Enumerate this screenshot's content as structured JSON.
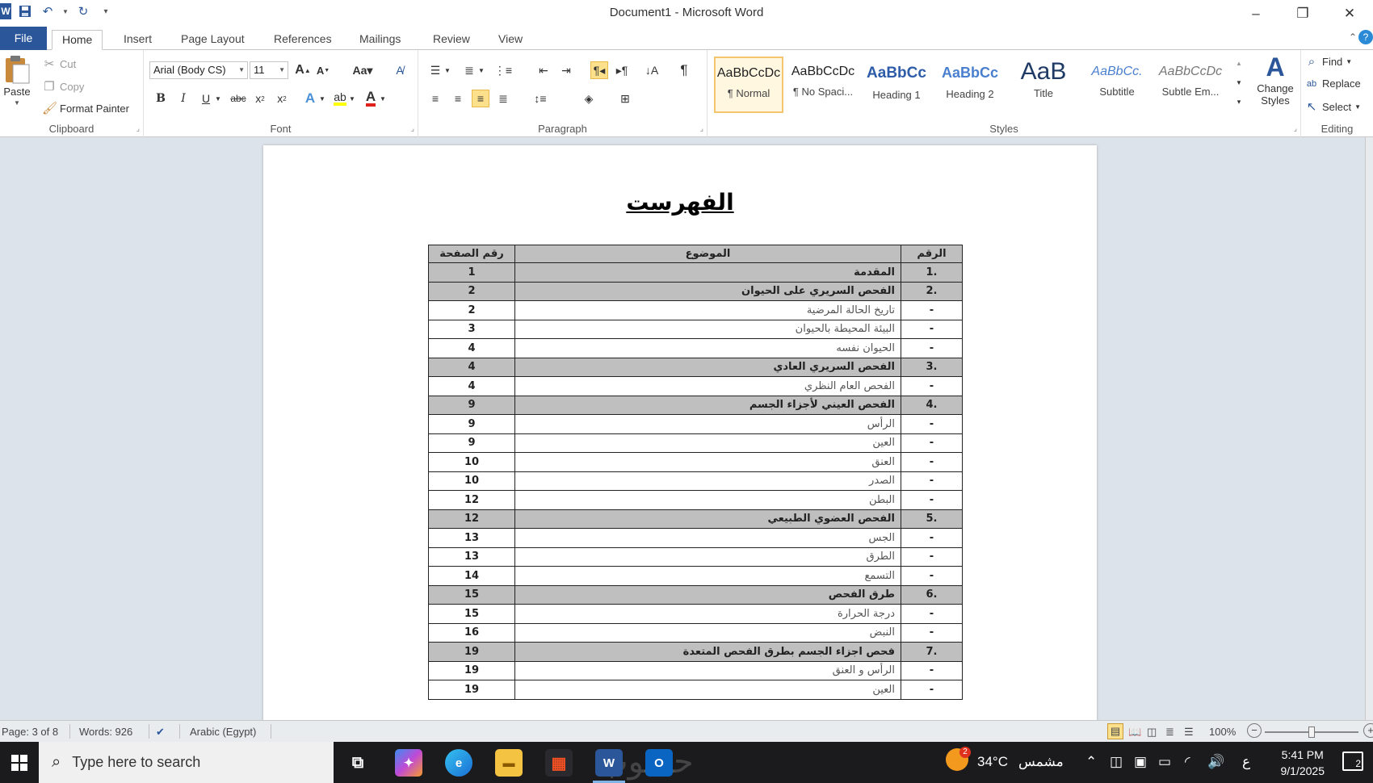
{
  "window": {
    "title": "Document1 - Microsoft Word"
  },
  "tabs": [
    "File",
    "Home",
    "Insert",
    "Page Layout",
    "References",
    "Mailings",
    "Review",
    "View"
  ],
  "ribbon": {
    "clipboard": {
      "label": "Clipboard",
      "paste": "Paste",
      "cut": "Cut",
      "copy": "Copy",
      "format_painter": "Format Painter"
    },
    "font": {
      "label": "Font",
      "family": "Arial (Body CS)",
      "size": "11"
    },
    "paragraph": {
      "label": "Paragraph"
    },
    "styles": {
      "label": "Styles",
      "items": [
        {
          "sample": "AaBbCcDc",
          "name": "¶ Normal"
        },
        {
          "sample": "AaBbCcDc",
          "name": "¶ No Spaci..."
        },
        {
          "sample": "AaBbCc",
          "name": "Heading 1"
        },
        {
          "sample": "AaBbCc",
          "name": "Heading 2"
        },
        {
          "sample": "AaB",
          "name": "Title"
        },
        {
          "sample": "AaBbCc.",
          "name": "Subtitle"
        },
        {
          "sample": "AaBbCcDc",
          "name": "Subtle Em..."
        }
      ],
      "change_styles": "Change Styles"
    },
    "editing": {
      "label": "Editing",
      "find": "Find",
      "replace": "Replace",
      "select": "Select"
    }
  },
  "document": {
    "heading": "الفهرست",
    "headers": {
      "num": "الرقم",
      "topic": "الموضوع",
      "page": "رقم الصفحة"
    },
    "rows": [
      {
        "num": ".1",
        "topic": "المقدمة",
        "page": "1",
        "main": true
      },
      {
        "num": ".2",
        "topic": "الفحص السريري على الحيوان",
        "page": "2",
        "main": true
      },
      {
        "num": "-",
        "topic": "تاريخ الحالة المرضية",
        "page": "2",
        "main": false
      },
      {
        "num": "-",
        "topic": "البيئة المحيطة بالحيوان",
        "page": "3",
        "main": false
      },
      {
        "num": "-",
        "topic": "الحيوان نفسه",
        "page": "4",
        "main": false
      },
      {
        "num": ".3",
        "topic": "الفحص السريري العادي",
        "page": "4",
        "main": true
      },
      {
        "num": "-",
        "topic": "الفحص العام النظري",
        "page": "4",
        "main": false
      },
      {
        "num": ".4",
        "topic": "الفحص العيني لأجزاء الجسم",
        "page": "9",
        "main": true
      },
      {
        "num": "-",
        "topic": "الرأس",
        "page": "9",
        "main": false
      },
      {
        "num": "-",
        "topic": "العين",
        "page": "9",
        "main": false
      },
      {
        "num": "-",
        "topic": "العنق",
        "page": "10",
        "main": false
      },
      {
        "num": "-",
        "topic": "الصدر",
        "page": "10",
        "main": false
      },
      {
        "num": "-",
        "topic": "البطن",
        "page": "12",
        "main": false
      },
      {
        "num": ".5",
        "topic": "الفحص العضوي الطبيعي",
        "page": "12",
        "main": true
      },
      {
        "num": "-",
        "topic": "الجس",
        "page": "13",
        "main": false
      },
      {
        "num": "-",
        "topic": "الطرق",
        "page": "13",
        "main": false
      },
      {
        "num": "-",
        "topic": "التسمع",
        "page": "14",
        "main": false
      },
      {
        "num": ".6",
        "topic": "طرق الفحص",
        "page": "15",
        "main": true
      },
      {
        "num": "-",
        "topic": "درجة الحرارة",
        "page": "15",
        "main": false
      },
      {
        "num": "-",
        "topic": "النبض",
        "page": "16",
        "main": false
      },
      {
        "num": ".7",
        "topic": "فحص اجزاء الجسم بطرق الفحص المتعدة",
        "page": "19",
        "main": true
      },
      {
        "num": "-",
        "topic": "الرأس و العنق",
        "page": "19",
        "main": false
      },
      {
        "num": "-",
        "topic": "العين",
        "page": "19",
        "main": false
      }
    ]
  },
  "status": {
    "page": "Page: 3 of 8",
    "words": "Words: 926",
    "language": "Arabic (Egypt)",
    "zoom": "100%",
    "zoom_level": 0.5
  },
  "taskbar": {
    "search_placeholder": "Type here to search",
    "weather": "34°C",
    "weather_desc": "مشمس",
    "weather_badge": "2",
    "lang": "ع",
    "time": "5:41 PM",
    "date": "9/1/2025",
    "notifications": "2",
    "watermark": "حسوب"
  }
}
